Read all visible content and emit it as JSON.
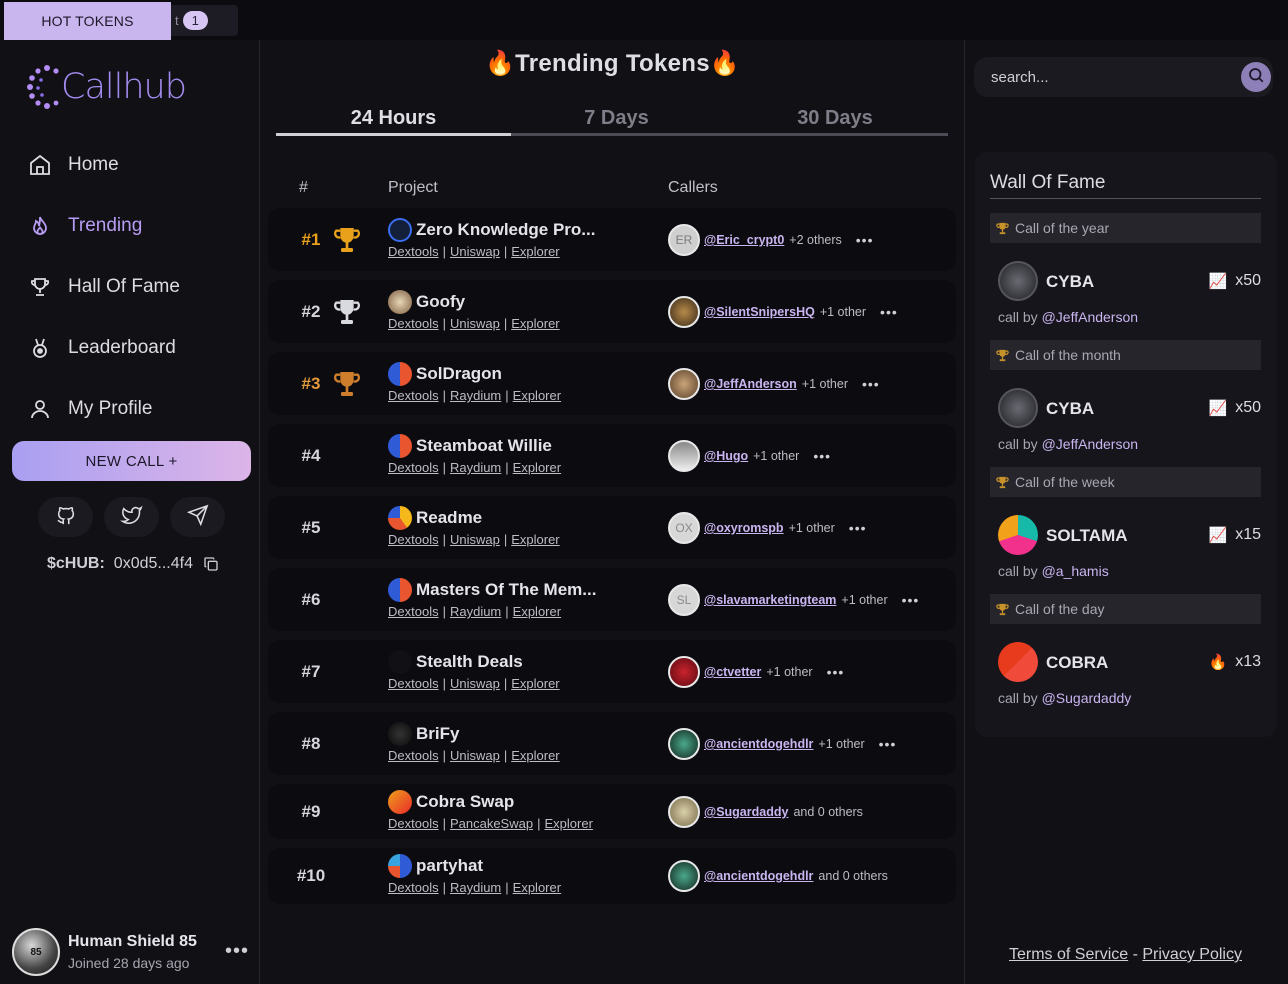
{
  "topbar": {
    "hot_tokens_label": "HOT TOKENS",
    "ticker_fragment": "t",
    "ticker_badge": "1"
  },
  "sidebar": {
    "logo_text": "Callhub",
    "nav": [
      {
        "label": "Home",
        "icon": "home-icon"
      },
      {
        "label": "Trending",
        "icon": "flame-icon",
        "active": true
      },
      {
        "label": "Hall Of Fame",
        "icon": "trophy-icon"
      },
      {
        "label": "Leaderboard",
        "icon": "medal-icon"
      },
      {
        "label": "My Profile",
        "icon": "user-icon"
      }
    ],
    "new_call_label": "NEW CALL +",
    "socials": [
      "github-icon",
      "twitter-icon",
      "telegram-icon"
    ],
    "token_symbol": "$cHUB:",
    "token_address": "0x0d5...4f4",
    "profile": {
      "name": "Human Shield 85",
      "joined": "Joined 28 days ago",
      "avatar_text": "85"
    }
  },
  "main": {
    "title": "Trending Tokens",
    "tabs": [
      {
        "label": "24 Hours",
        "active": true
      },
      {
        "label": "7 Days"
      },
      {
        "label": "30 Days"
      }
    ],
    "headers": {
      "rank": "#",
      "project": "Project",
      "callers": "Callers"
    },
    "rows": [
      {
        "rank": "#1",
        "trophy": "gold",
        "name": "Zero Knowledge Pro...",
        "links": [
          "Dextools",
          "Uniswap",
          "Explorer"
        ],
        "caller": "@Eric_crypt0",
        "others": "+2 others",
        "more": true,
        "avatar_text": "ER"
      },
      {
        "rank": "#2",
        "trophy": "silver",
        "name": "Goofy",
        "links": [
          "Dextools",
          "Uniswap",
          "Explorer"
        ],
        "caller": "@SilentSnipersHQ",
        "others": "+1 other",
        "more": true,
        "avatar_text": ""
      },
      {
        "rank": "#3",
        "trophy": "bronze",
        "name": "SolDragon",
        "links": [
          "Dextools",
          "Raydium",
          "Explorer"
        ],
        "caller": "@JeffAnderson",
        "others": "+1 other",
        "more": true,
        "avatar_text": ""
      },
      {
        "rank": "#4",
        "trophy": "",
        "name": "Steamboat Willie",
        "links": [
          "Dextools",
          "Raydium",
          "Explorer"
        ],
        "caller": "@Hugo",
        "others": "+1 other",
        "more": true,
        "avatar_text": ""
      },
      {
        "rank": "#5",
        "trophy": "",
        "name": "Readme",
        "links": [
          "Dextools",
          "Uniswap",
          "Explorer"
        ],
        "caller": "@oxyromspb",
        "others": "+1 other",
        "more": true,
        "avatar_text": "OX"
      },
      {
        "rank": "#6",
        "trophy": "",
        "name": "Masters Of The Mem...",
        "links": [
          "Dextools",
          "Raydium",
          "Explorer"
        ],
        "caller": "@slavamarketingteam",
        "others": "+1 other",
        "more": true,
        "avatar_text": "SL"
      },
      {
        "rank": "#7",
        "trophy": "",
        "name": "Stealth Deals",
        "links": [
          "Dextools",
          "Uniswap",
          "Explorer"
        ],
        "caller": "@ctvetter",
        "others": "+1 other",
        "more": true,
        "avatar_text": ""
      },
      {
        "rank": "#8",
        "trophy": "",
        "name": "BriFy",
        "links": [
          "Dextools",
          "Uniswap",
          "Explorer"
        ],
        "caller": "@ancientdogehdlr",
        "others": "+1 other",
        "more": true,
        "avatar_text": ""
      },
      {
        "rank": "#9",
        "trophy": "",
        "name": "Cobra Swap",
        "links": [
          "Dextools",
          "PancakeSwap",
          "Explorer"
        ],
        "caller": "@Sugardaddy",
        "others": "and 0 others",
        "more": false,
        "avatar_text": ""
      },
      {
        "rank": "#10",
        "trophy": "",
        "name": "partyhat",
        "links": [
          "Dextools",
          "Raydium",
          "Explorer"
        ],
        "caller": "@ancientdogehdlr",
        "others": "and 0 others",
        "more": false,
        "avatar_text": ""
      }
    ]
  },
  "right": {
    "search_placeholder": "search...",
    "wall_title": "Wall Of Fame",
    "sections": [
      {
        "heading": "Call of the year",
        "token": "CYBA",
        "multiplier": "x50",
        "emoji": "📈",
        "by_prefix": "call by",
        "by_handle": "@JeffAnderson"
      },
      {
        "heading": "Call of the month",
        "token": "CYBA",
        "multiplier": "x50",
        "emoji": "📈",
        "by_prefix": "call by",
        "by_handle": "@JeffAnderson"
      },
      {
        "heading": "Call of the week",
        "token": "SOLTAMA",
        "multiplier": "x15",
        "emoji": "📈",
        "by_prefix": "call by",
        "by_handle": "@a_hamis"
      },
      {
        "heading": "Call of the day",
        "token": "COBRA",
        "multiplier": "x13",
        "emoji": "🔥",
        "by_prefix": "call by",
        "by_handle": "@Sugardaddy"
      }
    ],
    "footer": {
      "terms": "Terms of Service",
      "sep": "-",
      "privacy": "Privacy Policy"
    }
  },
  "colors": {
    "accent": "#b79cf3",
    "gold": "#e9a11b",
    "bronze": "#e39a3c",
    "bg": "#111015",
    "card": "#0c0b10"
  }
}
